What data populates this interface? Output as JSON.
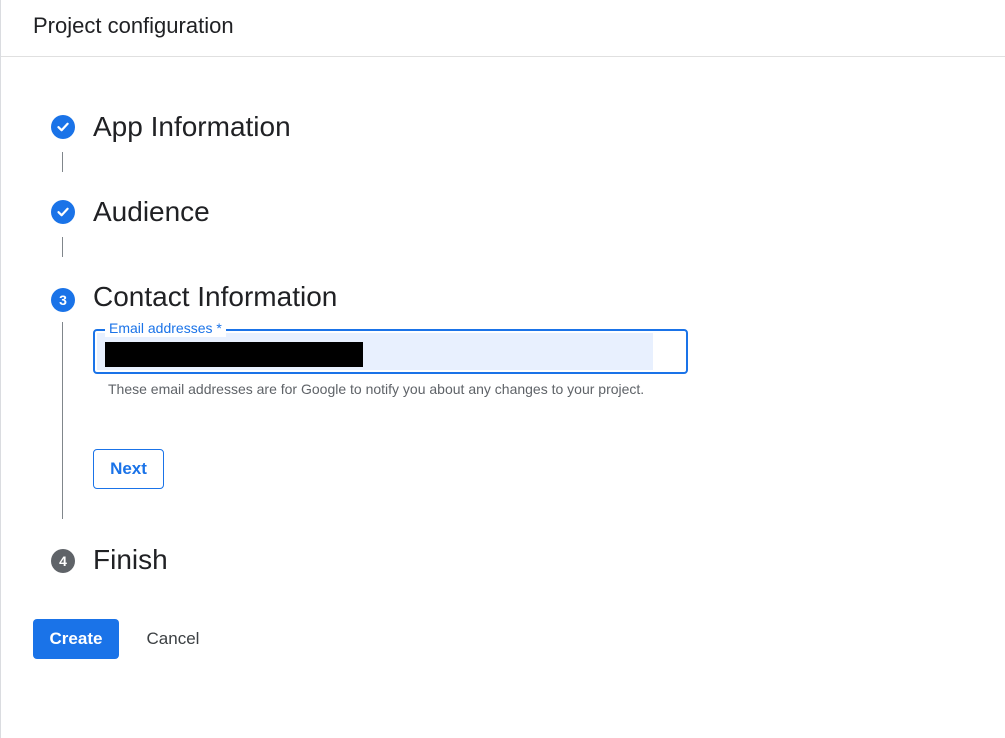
{
  "header": {
    "title": "Project configuration"
  },
  "steps": [
    {
      "number": "1",
      "title": "App Information",
      "state": "completed",
      "icon": "check-icon"
    },
    {
      "number": "2",
      "title": "Audience",
      "state": "completed",
      "icon": "check-icon"
    },
    {
      "number": "3",
      "title": "Contact Information",
      "state": "active"
    },
    {
      "number": "4",
      "title": "Finish",
      "state": "pending"
    }
  ],
  "contact": {
    "email_label": "Email addresses *",
    "email_value": "",
    "email_redacted": true,
    "hint": "These email addresses are for Google to notify you about any changes to your project.",
    "next_label": "Next"
  },
  "footer": {
    "create_label": "Create",
    "cancel_label": "Cancel"
  },
  "colors": {
    "accent": "#1a73e8",
    "autofill": "#e8f0fe",
    "pending_step": "#5f6368",
    "text": "#202124",
    "hint_text": "#5f6368"
  }
}
